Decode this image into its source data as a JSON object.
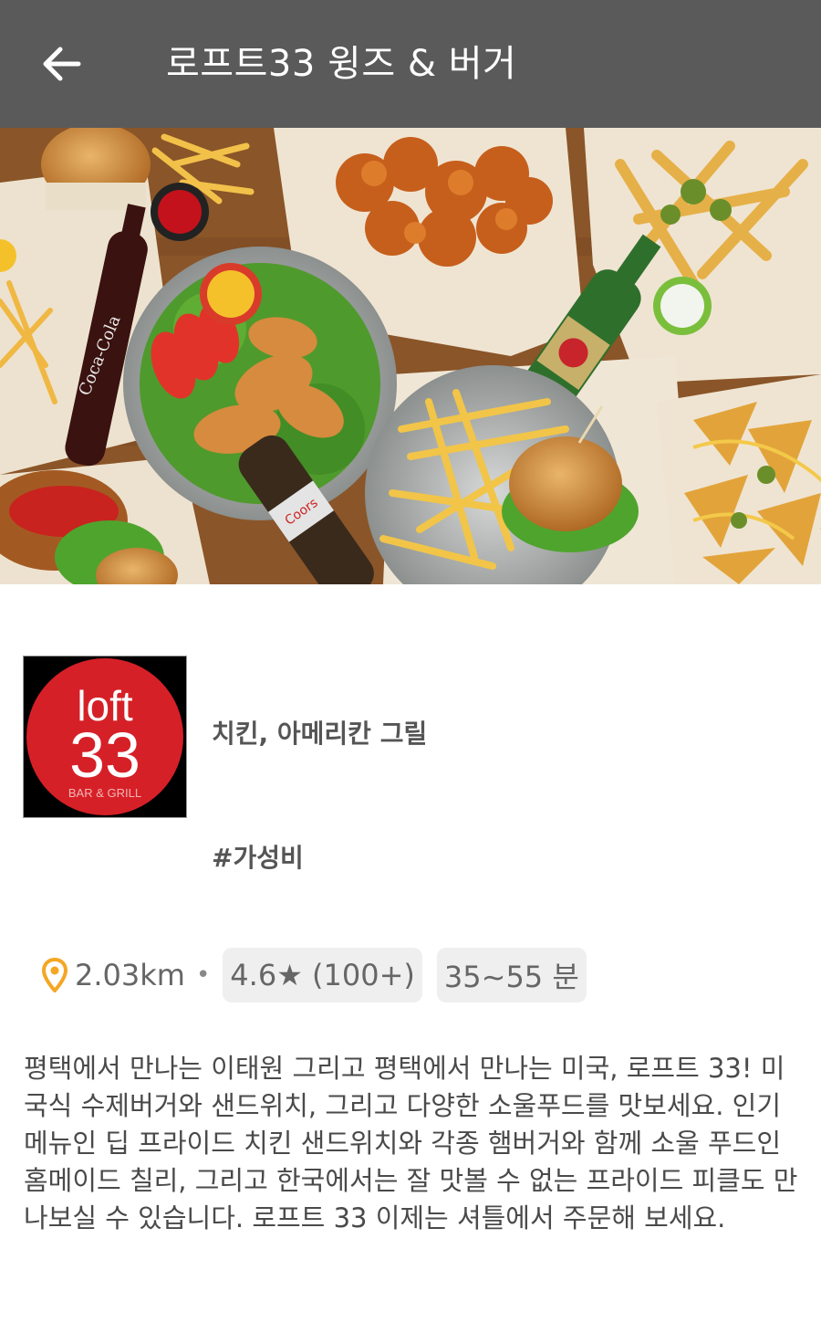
{
  "header": {
    "back_icon": "arrow-left-icon",
    "title": "로프트33 윙즈 & 버거"
  },
  "hero": {
    "image_description_icon": "food-platter-photo"
  },
  "restaurant": {
    "logo": {
      "line1": "loft",
      "line2": "33",
      "line3": "BAR & GRILL",
      "circle_color": "#d62027"
    },
    "category": "치킨, 아메리칸 그릴",
    "hashtag": "#가성비",
    "distance": "2.03km",
    "separator": "•",
    "rating": "4.6★ (100+)",
    "delivery_time": "35~55 분",
    "pin_color": "#f5a623",
    "description": "평택에서 만나는 이태원 그리고 평택에서 만나는 미국, 로프트 33! 미국식 수제버거와 샌드위치, 그리고 다양한 소울푸드를 맛보세요. 인기 메뉴인 딥 프라이드 치킨 샌드위치와 각종 햄버거와 함께 소울 푸드인 홈메이드 칠리, 그리고 한국에서는 잘 맛볼 수 없는 프라이드 피클도 만나보실 수 있습니다. 로프트 33 이제는 셔틀에서 주문해 보세요."
  }
}
